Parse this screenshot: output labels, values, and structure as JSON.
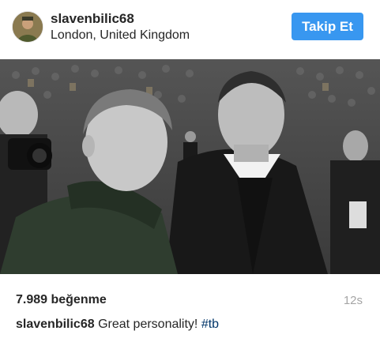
{
  "header": {
    "username": "slavenbilic68",
    "location": "London, United Kingdom",
    "follow_label": "Takip Et"
  },
  "post": {
    "likes": "7.989 beğenme",
    "time": "12s",
    "caption_user": "slavenbilic68",
    "caption_text": "Great personality!",
    "hashtag": "#tb"
  },
  "colors": {
    "follow_button": "#3897f0",
    "hashtag": "#003569",
    "muted_text": "#a5a5a5"
  }
}
